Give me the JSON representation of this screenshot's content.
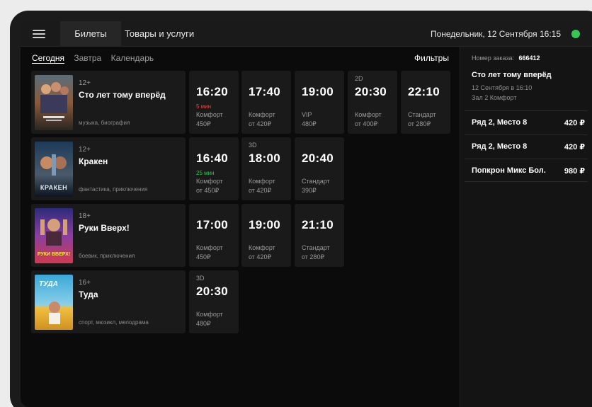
{
  "topbar": {
    "tabs": [
      {
        "label": "Билеты",
        "active": true
      },
      {
        "label": "Товары и услуги",
        "active": false
      }
    ],
    "datetime": "Понедельник, 12 Сентября   16:15",
    "status_color": "#35c653"
  },
  "subnav": {
    "items": [
      "Сегодня",
      "Завтра",
      "Календарь"
    ],
    "filters_label": "Фильтры"
  },
  "movies": [
    {
      "age": "12+",
      "title": "Сто лет тому вперёд",
      "genre": "музыка, биография",
      "sessions": [
        {
          "format": "",
          "time": "16:20",
          "soon": "5 мин",
          "soon_color": "#e04848",
          "hall": "Комфорт",
          "price": "450₽"
        },
        {
          "format": "",
          "time": "17:40",
          "soon": "",
          "hall": "Комфорт",
          "price": "от 420₽"
        },
        {
          "format": "",
          "time": "19:00",
          "soon": "",
          "hall": "VIP",
          "price": "480₽"
        },
        {
          "format": "2D",
          "time": "20:30",
          "soon": "",
          "hall": "Комфорт",
          "price": "от 400₽"
        },
        {
          "format": "",
          "time": "22:10",
          "soon": "",
          "hall": "Стандарт",
          "price": "от 280₽"
        }
      ]
    },
    {
      "age": "12+",
      "title": "Кракен",
      "genre": "фантастика, приключения",
      "poster_caption": "КРАКЕН",
      "sessions": [
        {
          "format": "",
          "time": "16:40",
          "soon": "25 мин",
          "soon_color": "#35c653",
          "hall": "Комфорт",
          "price": "от 450₽"
        },
        {
          "format": "3D",
          "time": "18:00",
          "soon": "",
          "hall": "Комфорт",
          "price": "от 420₽"
        },
        {
          "format": "",
          "time": "20:40",
          "soon": "",
          "hall": "Стандарт",
          "price": "390₽"
        }
      ]
    },
    {
      "age": "18+",
      "title": "Руки Вверх!",
      "genre": "боевик, приключения",
      "poster_caption": "РУКИ ВВЕРХ!",
      "sessions": [
        {
          "format": "",
          "time": "17:00",
          "soon": "",
          "hall": "Комфорт",
          "price": "450₽"
        },
        {
          "format": "",
          "time": "19:00",
          "soon": "",
          "hall": "Комфорт",
          "price": "от 420₽"
        },
        {
          "format": "",
          "time": "21:10",
          "soon": "",
          "hall": "Стандарт",
          "price": "от 280₽"
        }
      ]
    },
    {
      "age": "16+",
      "title": "Туда",
      "genre": "спорт, мюзикл, мелодрама",
      "poster_caption": "ТУДА",
      "sessions": [
        {
          "format": "3D",
          "time": "20:30",
          "soon": "",
          "hall": "Комфорт",
          "price": "480₽"
        }
      ]
    }
  ],
  "order": {
    "label": "Номер заказа:",
    "number": "666412",
    "title": "Сто лет тому вперёд",
    "date": "12 Сентября в 16:10",
    "hall": "Зал 2 Комфорт",
    "items": [
      {
        "label": "Ряд 2, Место 8",
        "price": "420 ₽"
      },
      {
        "label": "Ряд 2, Место 8",
        "price": "420 ₽"
      },
      {
        "label": "Попкрон Микс Бол.",
        "price": "980 ₽"
      }
    ]
  }
}
